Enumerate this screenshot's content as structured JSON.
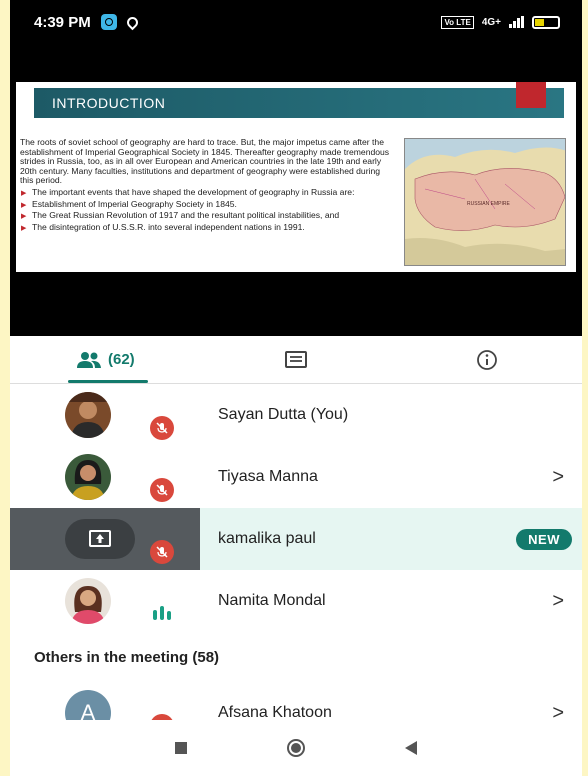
{
  "status_bar": {
    "time": "4:39 PM",
    "volte": "Vo LTE",
    "network": "4G+",
    "battery_level": 0.4
  },
  "slide": {
    "title": "INTRODUCTION",
    "paragraph": "The roots of soviet school of geography are hard to trace. But, the major impetus came after the establishment of Imperial Geographical Society in 1845. Thereafter geography made tremendous strides in Russia, too, as in all over European and American countries in the late 19th and early 20th century. Many faculties, institutions and department of geography were established during this period.",
    "bullets": [
      "The important events that have shaped the development of geography in Russia are:",
      "Establishment of Imperial Geography Society in 1845.",
      "The Great Russian Revolution of 1917 and the resultant political instabilities, and",
      "The disintegration of U.S.S.R. into several independent nations in 1991."
    ],
    "map_label": "RUSSIAN EMPIRE"
  },
  "tabs": {
    "people_count": "(62)"
  },
  "participants": [
    {
      "name": "Sayan Dutta (You)"
    },
    {
      "name": "Tiyasa Manna",
      "chevron": ">"
    },
    {
      "name": "kamalika paul",
      "badge": "NEW"
    },
    {
      "name": "Namita Mondal",
      "chevron": ">"
    }
  ],
  "others_heading": "Others in the meeting (58)",
  "others": [
    {
      "name": "Afsana Khatoon",
      "initial": "A",
      "chevron": ">"
    }
  ]
}
